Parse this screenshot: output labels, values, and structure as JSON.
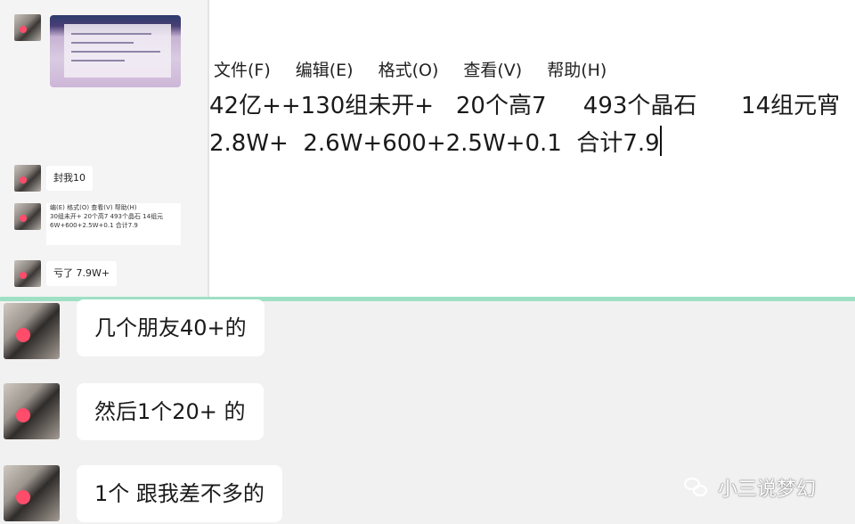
{
  "left_chat": {
    "messages": [
      {
        "text": "封我10"
      },
      {
        "text": "亏了 7.9W+"
      }
    ],
    "mini_note": {
      "menu": "编(E)  格式(O)  查看(V)  帮助(H)",
      "line1": "30组未开+   20个高7    493个晶石     14组元",
      "line2": "6W+600+2.5W+0.1  合计7.9"
    }
  },
  "notepad": {
    "menu": [
      "文件(F)",
      "编辑(E)",
      "格式(O)",
      "查看(V)",
      "帮助(H)"
    ],
    "lines": [
      "42亿++130组未开+   20个高7     493个晶石      14组元宵",
      "2.8W+  2.6W+600+2.5W+0.1  合计7.9"
    ]
  },
  "chat": {
    "messages": [
      {
        "text": "几个朋友40+的"
      },
      {
        "text": "然后1个20+ 的"
      },
      {
        "text": "1个 跟我差不多的"
      }
    ]
  },
  "watermark": {
    "text": "小三说梦幻",
    "icon": "wechat-icon"
  },
  "colors": {
    "divider": "#9fe0c4",
    "chat_bg": "#f1f1f1"
  }
}
